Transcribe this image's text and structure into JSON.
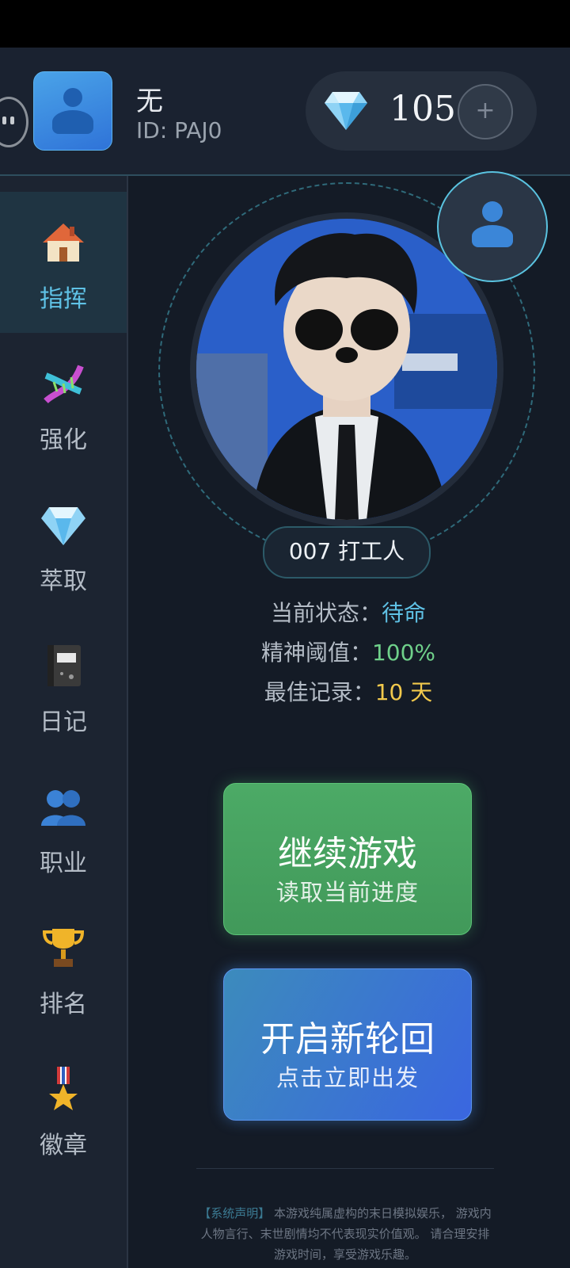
{
  "header": {
    "user_name": "无",
    "user_id": "ID: PAJ0",
    "gem_count": "105",
    "plus_label": "+"
  },
  "sidebar": {
    "items": [
      {
        "label": "指挥",
        "icon": "home-icon",
        "active": true
      },
      {
        "label": "强化",
        "icon": "dna-icon"
      },
      {
        "label": "萃取",
        "icon": "gem-icon"
      },
      {
        "label": "日记",
        "icon": "notebook-icon"
      },
      {
        "label": "职业",
        "icon": "users-icon"
      },
      {
        "label": "排名",
        "icon": "trophy-icon"
      },
      {
        "label": "徽章",
        "icon": "medal-icon"
      }
    ]
  },
  "profile": {
    "title": "007 打工人",
    "status_label": "当前状态：",
    "status_value": "待命",
    "sanity_label": "精神阈值：",
    "sanity_value": "100%",
    "record_label": "最佳记录：",
    "record_value": "10 天"
  },
  "buttons": {
    "continue_title": "继续游戏",
    "continue_sub": "读取当前进度",
    "new_title": "开启新轮回",
    "new_sub": "点击立即出发"
  },
  "disclaimer": {
    "tag": "【系统声明】",
    "text": "本游戏纯属虚构的末日模拟娱乐，  游戏内人物言行、末世剧情均不代表现实价值观。 请合理安排游戏时间，享受游戏乐趣。"
  },
  "colors": {
    "accent": "#5fc2e6",
    "status": "#5fc2e6",
    "sanity": "#6fd08a",
    "record": "#f2c94c",
    "continue_button": "#4caa66",
    "new_button": "#3a66e0"
  }
}
